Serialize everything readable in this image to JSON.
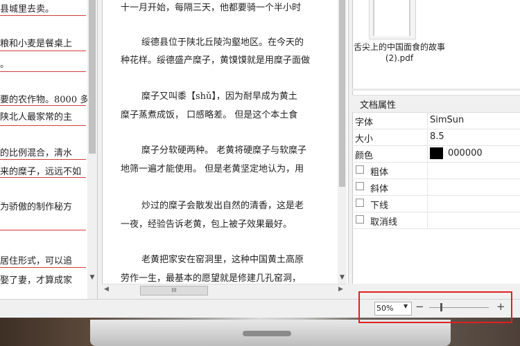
{
  "left_panel": {
    "lines": [
      "县城里去卖。",
      "粮和小麦是餐桌上",
      "。",
      "要的农作物。8000 多",
      "陕北人最家常的主",
      "的比例混合，清水",
      "来的糜子，远远不如",
      "为骄傲的制作秘方",
      "居住形式，可以追",
      "娶了妻，才算成家"
    ]
  },
  "document": {
    "lines": [
      "十一月开始，每隔三天，他都要骑一个半小时",
      "绥德县位于陕北丘陵沟壑地区。在今天的",
      "种花样。绥德盛产糜子，黄馍馍就是用糜子面做",
      "糜子又叫黍【shǔ】，因为耐旱成为黄土",
      "糜子蒸煮成饭，  口感略差。 但是这个本土食",
      "糜子分软硬两种。 老黄将硬糜子与软糜子",
      "地筛一遍才能使用。 但是老黄坚定地认为，用",
      "炒过的糜子会散发出自然的清香，这是老",
      "一夜，经验告诉老黄，包上被子效果最好。",
      "老黄把家安在窑洞里，这种中国黄土高原",
      "劳作一生，最基本的愿望就是修建几孔窑洞，"
    ],
    "hscroll_grip": "III"
  },
  "thumbnail": {
    "title_line1": "舌尖上的中国面食的故事",
    "title_line2": "(2).pdf"
  },
  "properties": {
    "header": "文档属性",
    "font_label": "字体",
    "font_value": "SimSun",
    "size_label": "大小",
    "size_value": "8.5",
    "color_label": "颜色",
    "color_value": "000000",
    "color_swatch": "#000000",
    "bold_label": "粗体",
    "italic_label": "斜体",
    "underline_label": "下线",
    "strike_label": "取消线"
  },
  "status": {
    "zoom_value": "50%",
    "zoom_minus": "−",
    "zoom_plus": "+",
    "zoom_level_fraction": 0.2
  },
  "icons": {
    "scroll_up": "chevron-up-icon",
    "scroll_down": "chevron-down-icon",
    "dropdown": "caret-down-icon"
  },
  "colors": {
    "highlight": "#e02020",
    "rule": "#d43a3a"
  }
}
